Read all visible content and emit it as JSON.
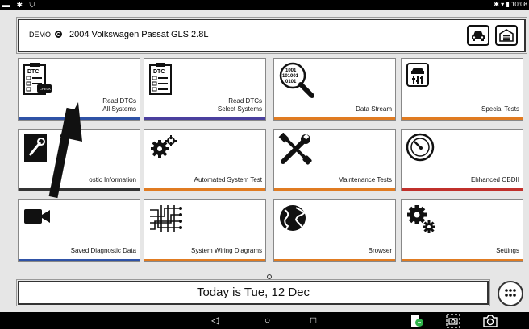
{
  "statusbar": {
    "left_icons": "▬ ✱ ⛉",
    "right_text": "✱ ▾ ▮ 10:08"
  },
  "vehicle": {
    "demo_label": "DEMO",
    "name": "2004 Volkswagen Passat GLS 2.8L"
  },
  "tiles": [
    {
      "label": "Read DTCs\nAll Systems",
      "stripe": "#2f52a6",
      "icon": "dtc-clipboard-icon"
    },
    {
      "label": "Read DTCs\nSelect Systems",
      "stripe": "#4a3f9e",
      "icon": "dtc-clipboard-icon"
    },
    {
      "label": "Data Stream",
      "stripe": "#e07b21",
      "icon": "binary-magnifier-icon"
    },
    {
      "label": "Special Tests",
      "stripe": "#e07b21",
      "icon": "car-sliders-icon"
    },
    {
      "label": "Diagnostic Information",
      "stripe": "#333333",
      "icon": "wrench-book-icon"
    },
    {
      "label": "Automated System Test",
      "stripe": "#e07b21",
      "icon": "gears-icon"
    },
    {
      "label": "Maintenance Tests",
      "stripe": "#e07b21",
      "icon": "tools-icon"
    },
    {
      "label": "Ehhanced OBDII",
      "stripe": "#c0302b",
      "icon": "gauge-icon"
    },
    {
      "label": "Saved Diagnostic Data",
      "stripe": "#2f52a6",
      "icon": "video-camera-icon"
    },
    {
      "label": "System Wiring Diagrams",
      "stripe": "#e07b21",
      "icon": "circuit-icon"
    },
    {
      "label": "Browser",
      "stripe": "#e07b21",
      "icon": "globe-icon"
    },
    {
      "label": "Settings",
      "stripe": "#e07b21",
      "icon": "settings-gears-icon"
    }
  ],
  "tile6_label_visible": "ostic Information",
  "date_text": "Today is Tue, 12 Dec",
  "navbar": {
    "back": "◁",
    "home": "○",
    "recents": "□"
  }
}
